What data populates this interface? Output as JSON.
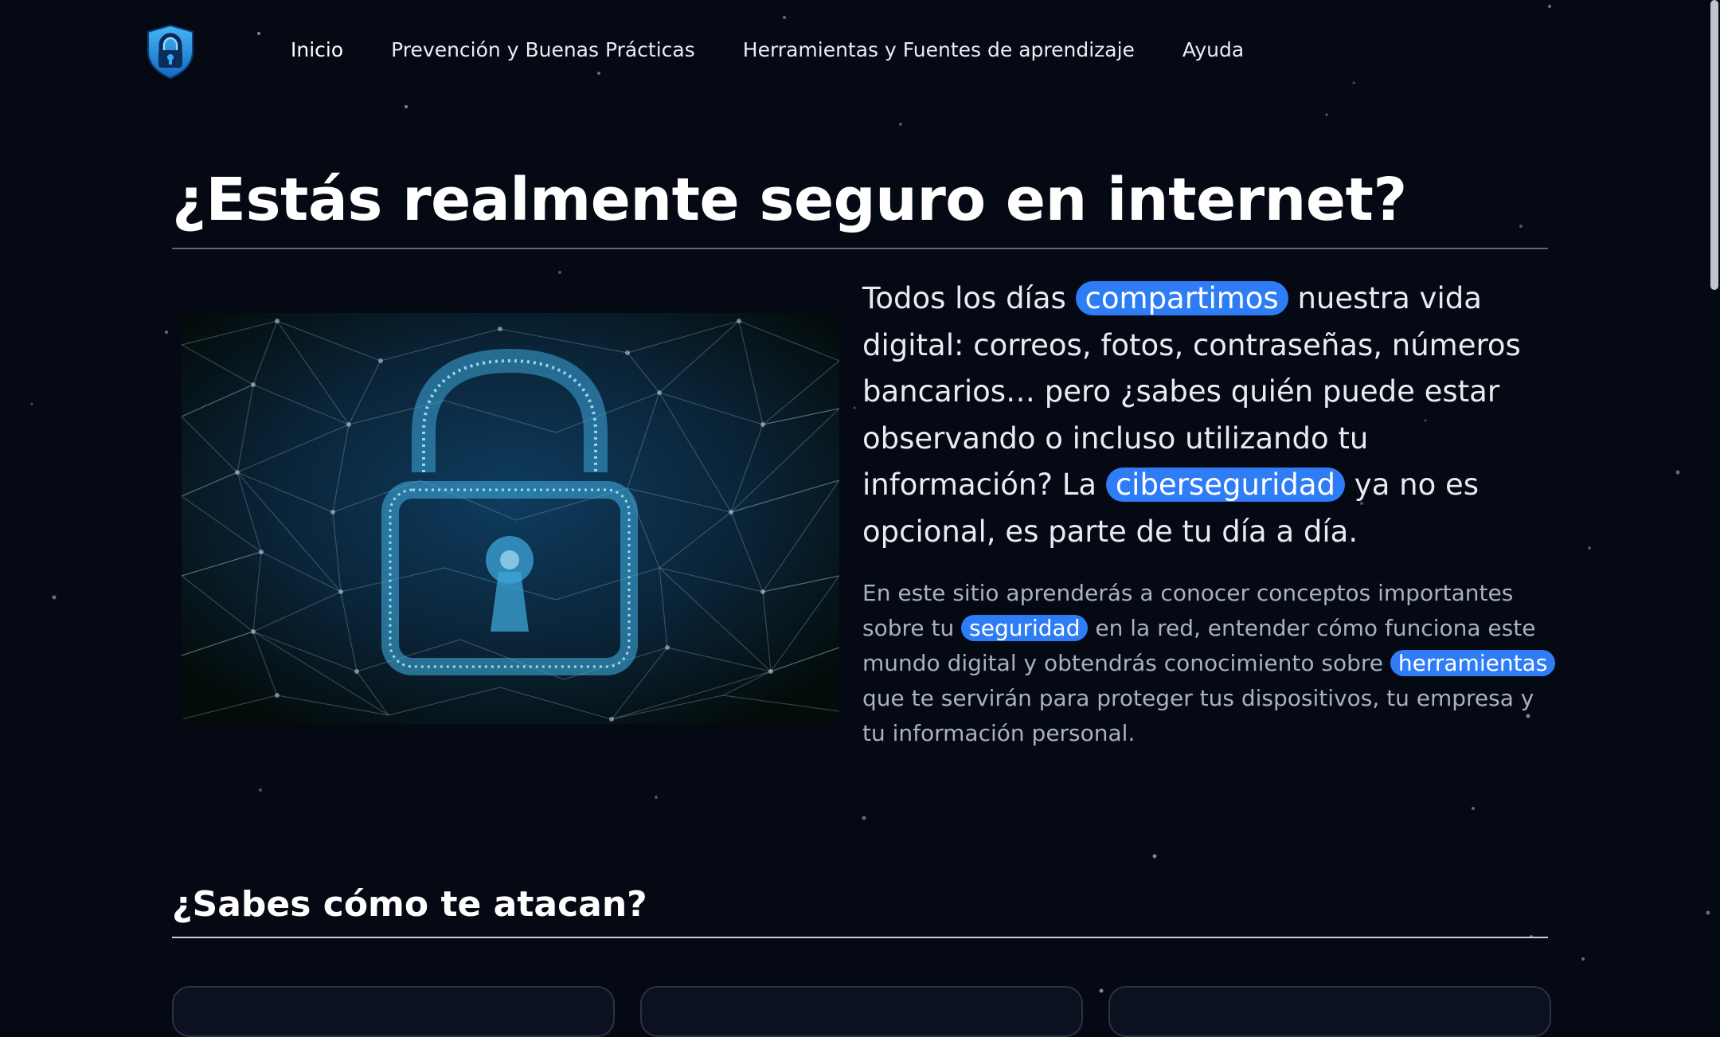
{
  "nav": {
    "logo_alt": "shield-lock-logo",
    "items": [
      "Inicio",
      "Prevención y Buenas Prácticas",
      "Herramientas y Fuentes de aprendizaje",
      "Ayuda"
    ]
  },
  "hero": {
    "title": "¿Estás realmente seguro en internet?",
    "image_icon": "padlock-network-icon",
    "lead": {
      "p1": "Todos los días ",
      "h1": "compartimos",
      "p2": " nuestra vida digital: correos, fotos, contraseñas, números bancarios… pero ¿sabes quién puede estar observando o incluso utilizando tu información? La ",
      "h2": "ciberseguridad",
      "p3": " ya no es opcional, es parte de tu día a día."
    },
    "body": {
      "p1": "En este sitio aprenderás a conocer conceptos importantes sobre tu ",
      "h1": "seguridad",
      "p2": " en la red, entender cómo funciona este mundo digital y obtendrás conocimiento sobre ",
      "h2": "herramientas",
      "p3": " que te servirán para proteger tus dispositivos, tu empresa y tu información personal."
    }
  },
  "attacks": {
    "title": "¿Sabes cómo te atacan?"
  },
  "colors": {
    "background": "#050914",
    "accent": "#2f7df6",
    "logo": "#1f8fe0"
  }
}
